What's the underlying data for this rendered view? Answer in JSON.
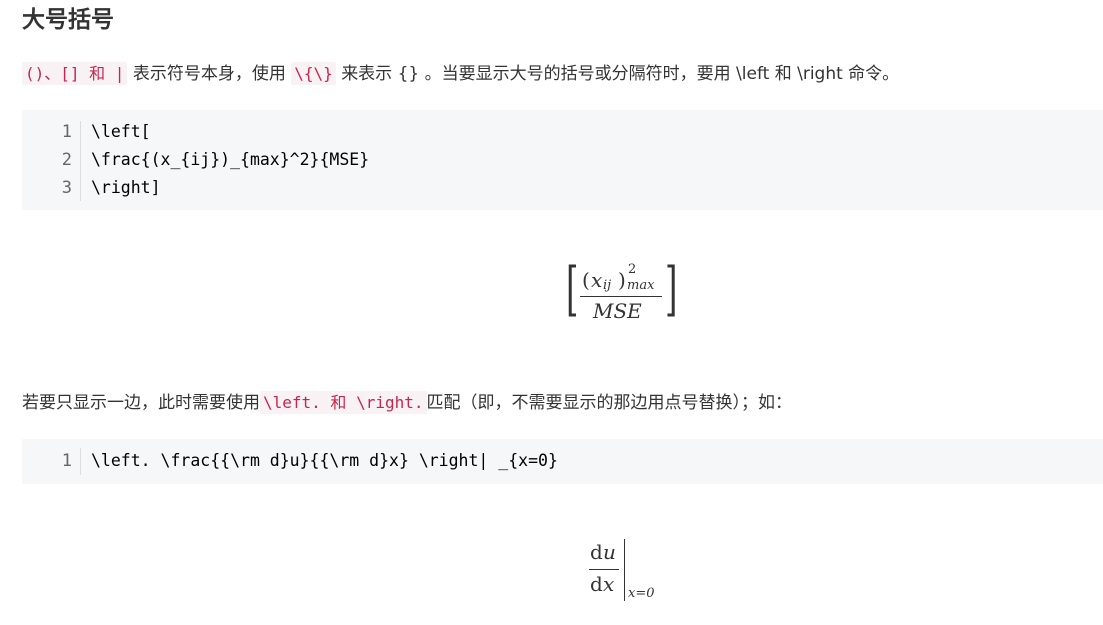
{
  "heading": "大号括号",
  "para1": {
    "code_parens": "()、[] 和 |",
    "text_a": "表示符号本身，使用",
    "code_braces": "\\{\\}",
    "text_b": "来表示 {} 。当要显示大号的括号或分隔符时，要用 \\left 和 \\right 命令。"
  },
  "code1": {
    "lines": [
      {
        "num": "1",
        "code": "\\left["
      },
      {
        "num": "2",
        "code": "\\frac{(x_{ij})_{max}^2}{MSE}"
      },
      {
        "num": "3",
        "code": "\\right]"
      }
    ]
  },
  "formula1": {
    "open_bracket": "[",
    "close_bracket": "]",
    "numerator_lparen": "(",
    "numerator_base": "x",
    "numerator_base_sub": "ij",
    "numerator_rparen": ")",
    "numerator_sup": "2",
    "numerator_sub": "max",
    "denominator": "MSE"
  },
  "para2": {
    "text_a": "若要只显示一边，此时需要使用",
    "code_left_right": "\\left. 和 \\right.",
    "text_b": "匹配（即，不需要显示的那边用点号替换）；如："
  },
  "code2": {
    "lines": [
      {
        "num": "1",
        "code": "\\left. \\frac{{\\rm d}u}{{\\rm d}x} \\right| _{x=0}"
      }
    ]
  },
  "formula2": {
    "numerator_d": "d",
    "numerator_var": "u",
    "denominator_d": "d",
    "denominator_var": "x",
    "eval_sub": "x=0"
  }
}
